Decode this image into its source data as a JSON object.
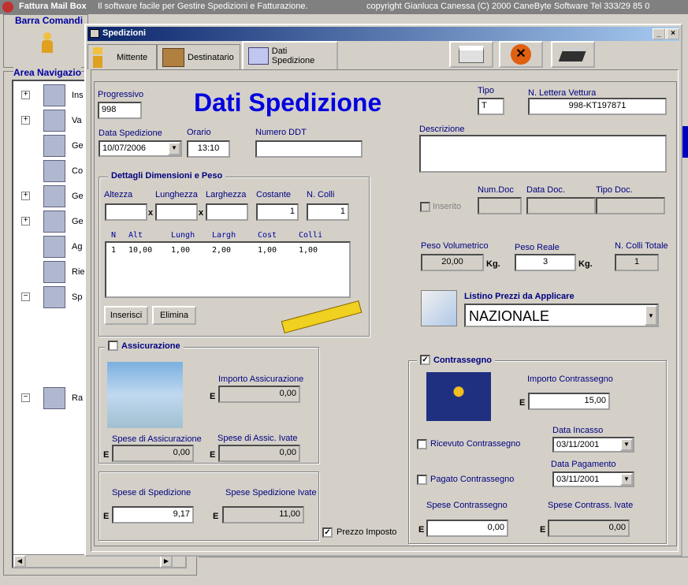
{
  "app": {
    "title": "Fattura Mail Box",
    "tagline": "Il software facile per Gestire Spedizioni e Fatturazione.",
    "copyright": "copyright Gianluca Canessa (C) 2000 CaneByte Software  Tel 333/29 85 0"
  },
  "left": {
    "barra_comandi": "Barra Comandi",
    "area_navigazione": "Area Navigazio",
    "tree": [
      "Ins",
      "Va",
      "Ge",
      "Co",
      "Ge",
      "Ge",
      "Ag",
      "Rie",
      "Sp",
      "Ra"
    ]
  },
  "win": {
    "title": "Spedizioni",
    "tabs": [
      "Mittente",
      "Destinatario",
      "Dati Spedizione"
    ]
  },
  "header": {
    "heading": "Dati Spedizione",
    "progressivo_label": "Progressivo",
    "progressivo": "998",
    "tipo_label": "Tipo",
    "tipo": "T",
    "lettera_label": "N. Lettera Vettura",
    "lettera": "998-KT197871"
  },
  "row2": {
    "data_label": "Data Spedizione",
    "data": "10/07/2006",
    "orario_label": "Orario",
    "orario": "13:10",
    "ddt_label": "Numero DDT",
    "ddt": "",
    "descrizione_label": "Descrizione",
    "descrizione": ""
  },
  "dettagli": {
    "title": "Dettagli Dimensioni e Peso",
    "altezza": "Altezza",
    "lunghezza": "Lunghezza",
    "larghezza": "Larghezza",
    "costante": "Costante",
    "ncolli": "N. Colli",
    "altezza_val": "",
    "lunghezza_val": "",
    "larghezza_val": "",
    "costante_val": "1",
    "ncolli_val": "1",
    "x": "x",
    "grid_headers": [
      "N",
      "Alt",
      "Lungh",
      "Largh",
      "Cost",
      "Colli"
    ],
    "grid_rows": [
      [
        "1",
        "10,00",
        "1,00",
        "2,00",
        "1,00",
        "1,00"
      ]
    ],
    "inserisci": "Inserisci",
    "elimina": "Elimina"
  },
  "inserito": {
    "label": "Inserito",
    "numdoc_label": "Num.Doc",
    "datadoc_label": "Data Doc.",
    "tipodoc_label": "Tipo Doc."
  },
  "pesi": {
    "vol_label": "Peso Volumetrico",
    "vol": "20,00",
    "kg": "Kg.",
    "reale_label": "Peso Reale",
    "reale": "3",
    "colli_label": "N. Colli Totale",
    "colli": "1"
  },
  "listino": {
    "label": "Listino Prezzi da Applicare",
    "value": "NAZIONALE"
  },
  "assic": {
    "label": "Assicurazione",
    "importo_label": "Importo Assicurazione",
    "importo": "0,00",
    "spese_label": "Spese di Assicurazione",
    "spese": "0,00",
    "ivate_label": "Spese di Assic. Ivate",
    "ivate": "0,00",
    "e": "E"
  },
  "sped": {
    "spese_label": "Spese di Spedizione",
    "spese": "9,17",
    "ivate_label": "Spese Spedizione Ivate",
    "ivate": "11,00",
    "prezzo_imposto": "Prezzo Imposto"
  },
  "contr": {
    "label": "Contrassegno",
    "importo_label": "Importo Contrassegno",
    "importo": "15,00",
    "ricevuto": "Ricevuto Contrassegno",
    "incasso_label": "Data Incasso",
    "incasso": "03/11/2001",
    "pagato": "Pagato Contrassegno",
    "pagamento_label": "Data Pagamento",
    "pagamento": "03/11/2001",
    "spese_label": "Spese Contrassegno",
    "spese": "0,00",
    "ivate_label": "Spese Contrass. Ivate",
    "ivate": "0,00"
  },
  "check": "✓"
}
